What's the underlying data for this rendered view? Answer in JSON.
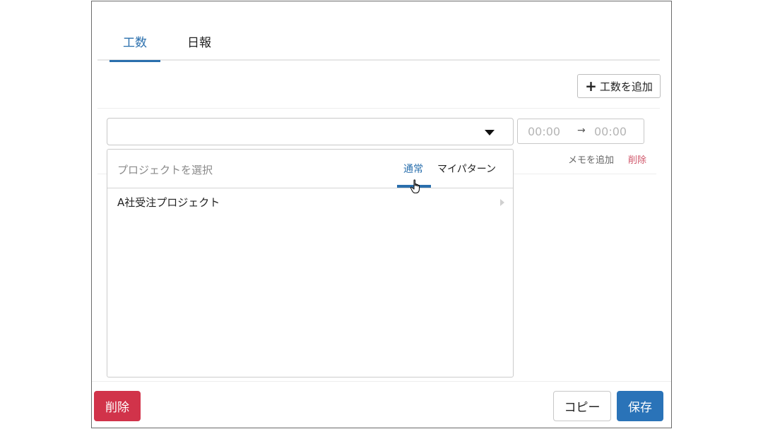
{
  "tabs": {
    "koushu": "工数",
    "nippo": "日報",
    "active": "工数"
  },
  "actions": {
    "add_koushu": "工数を追加"
  },
  "entry": {
    "project_value": "",
    "time_start": "00:00",
    "time_end": "00:00",
    "memo_link": "メモを追加",
    "delete_link": "削除"
  },
  "dropdown": {
    "placeholder": "プロジェクトを選択",
    "tab_normal": "通常",
    "tab_mypattern": "マイパターン",
    "active_tab": "通常",
    "items": [
      {
        "label": "A社受注プロジェクト"
      }
    ]
  },
  "footer": {
    "delete": "削除",
    "copy": "コピー",
    "save": "保存"
  },
  "colors": {
    "accent": "#2a6fad",
    "danger": "#d1334a",
    "primary": "#2a73b8",
    "delete_link": "#d0566a"
  },
  "icons": {
    "add": "plus-icon",
    "dropdown": "caret-down-icon",
    "time_arrow": "arrow-right-icon",
    "item_more": "chevron-right-icon",
    "pointer": "hand-pointer-icon"
  }
}
